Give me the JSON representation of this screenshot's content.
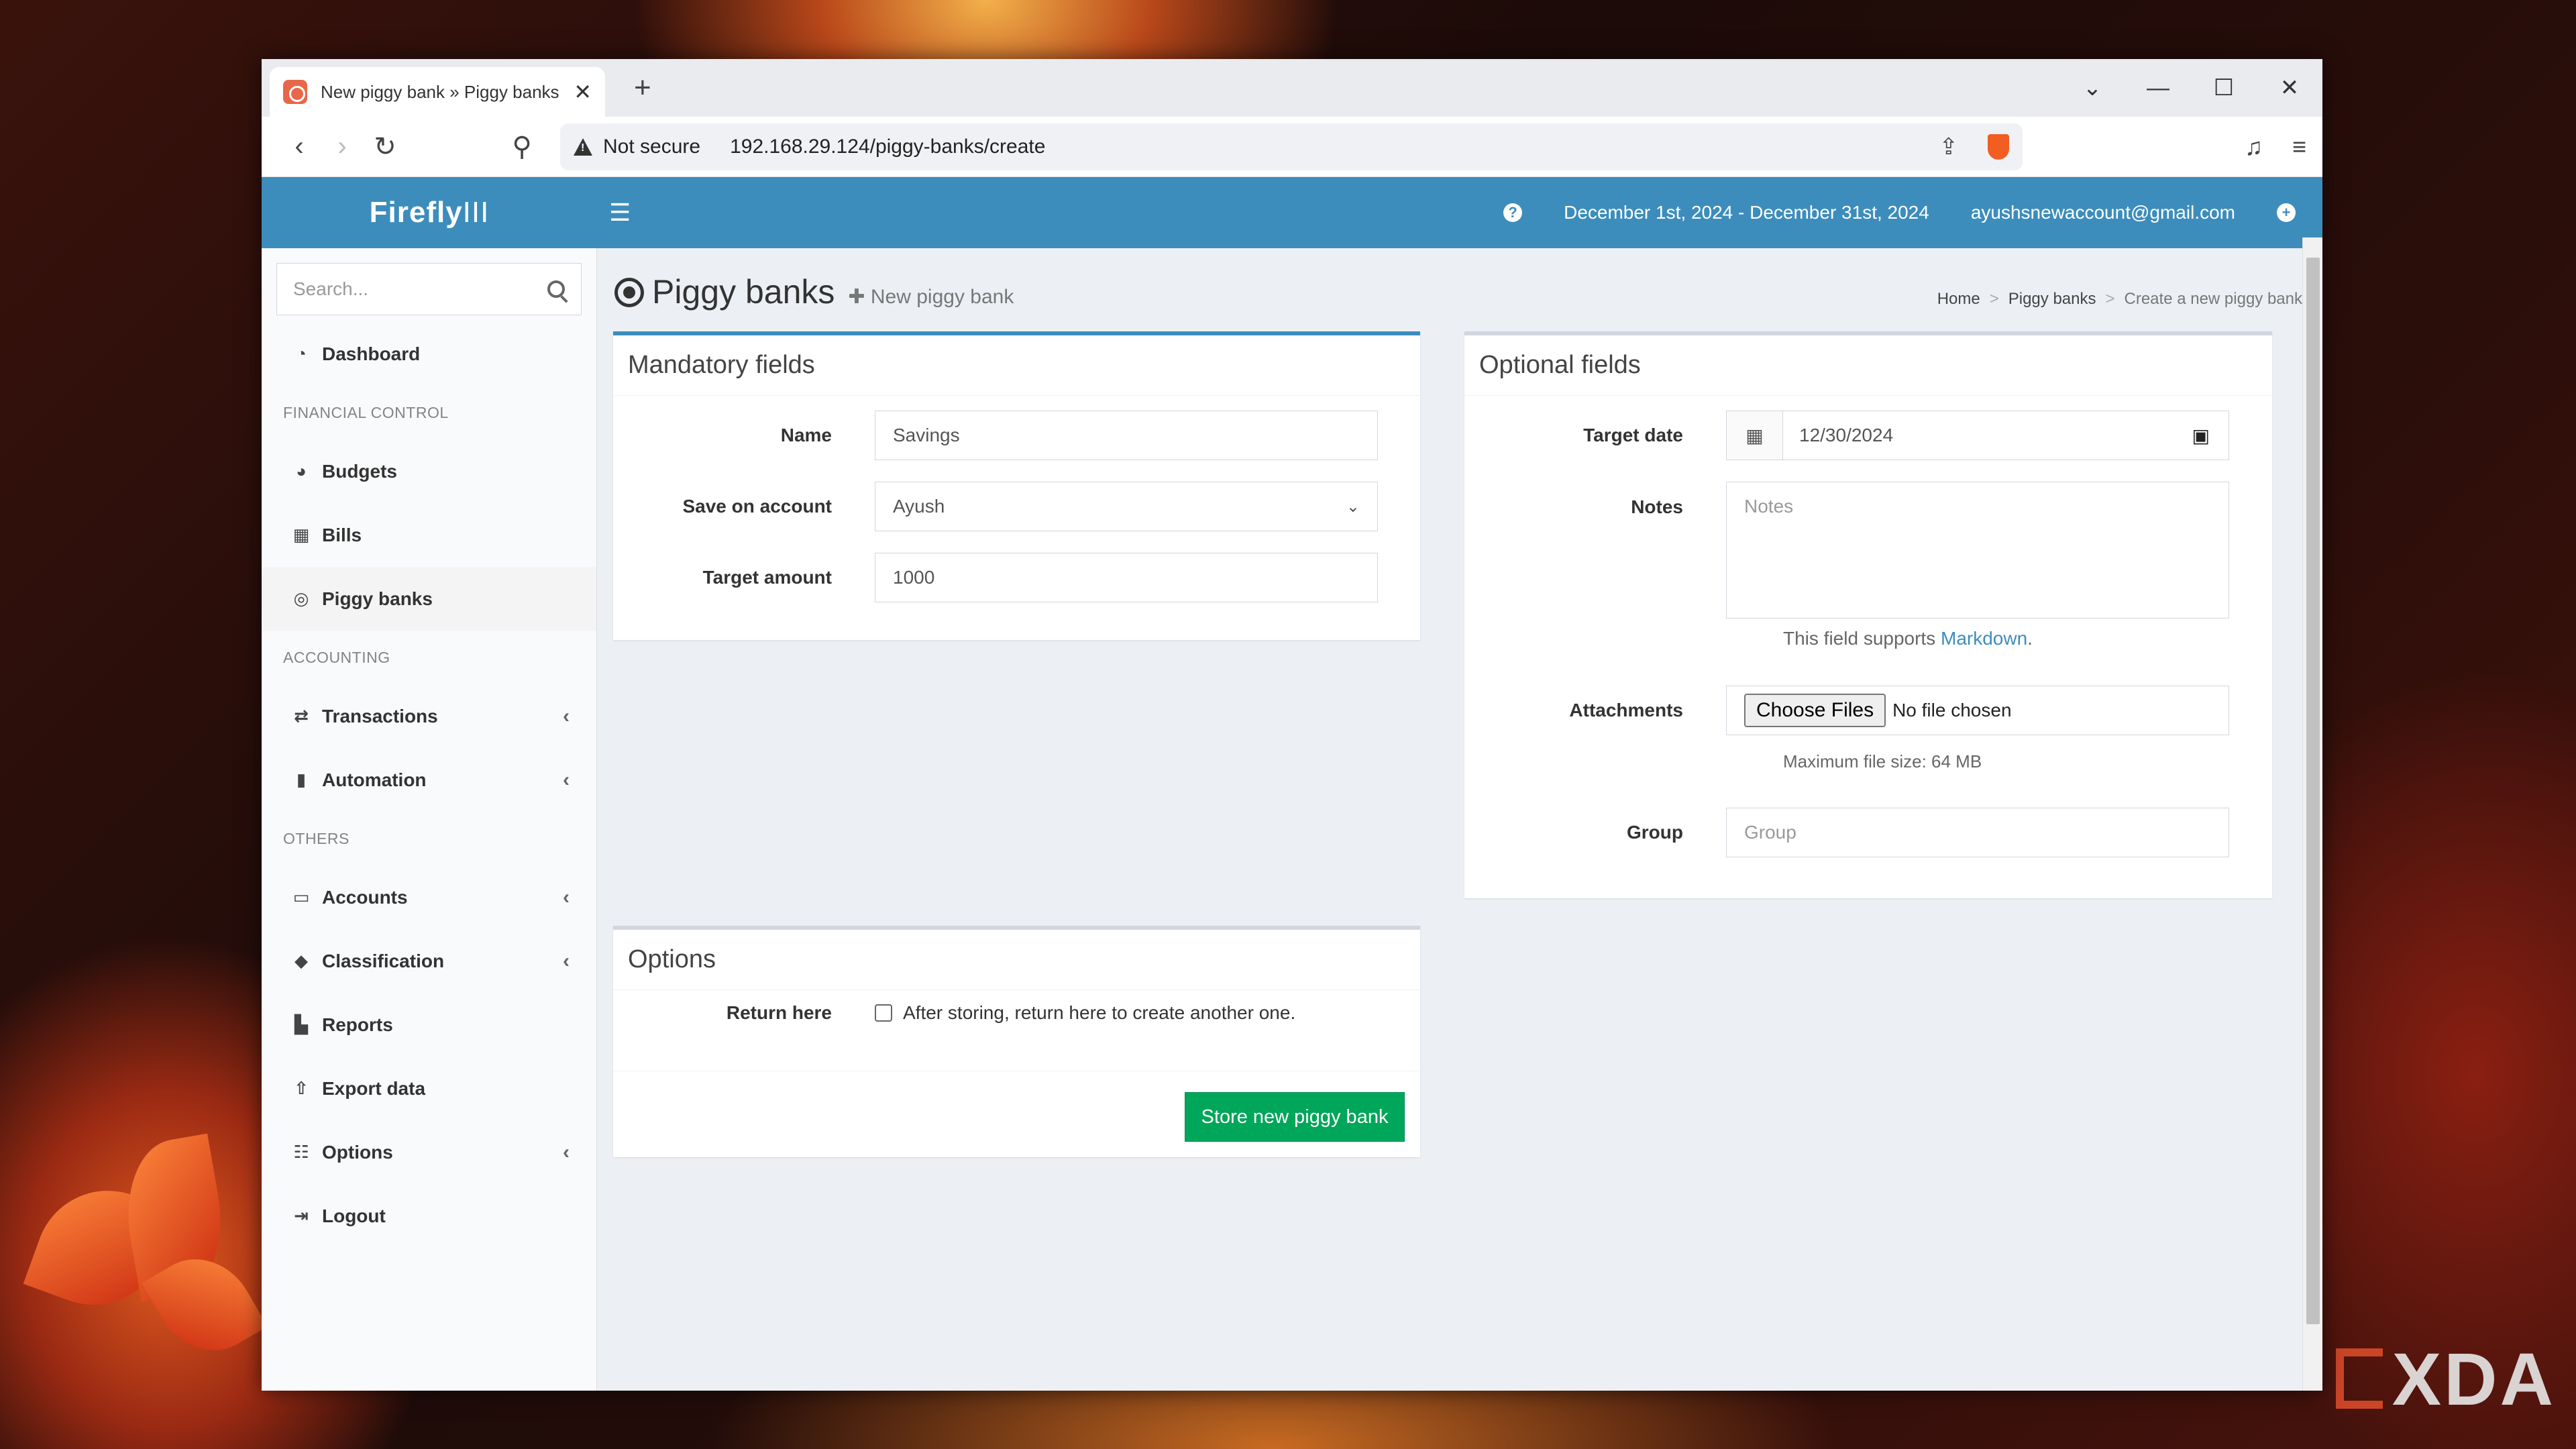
{
  "browser": {
    "tab_title": "New piggy bank » Piggy banks",
    "security_label": "Not secure",
    "url": "192.168.29.124/piggy-banks/create"
  },
  "app": {
    "logo_main": "Firefly",
    "logo_suffix": "III",
    "date_range": "December 1st, 2024 - December 31st, 2024",
    "user_email": "ayushsnewaccount@gmail.com"
  },
  "sidebar": {
    "search_placeholder": "Search...",
    "dashboard": "Dashboard",
    "header_financial": "FINANCIAL CONTROL",
    "budgets": "Budgets",
    "bills": "Bills",
    "piggy_banks": "Piggy banks",
    "header_accounting": "ACCOUNTING",
    "transactions": "Transactions",
    "automation": "Automation",
    "header_others": "OTHERS",
    "accounts": "Accounts",
    "classification": "Classification",
    "reports": "Reports",
    "export_data": "Export data",
    "options": "Options",
    "logout": "Logout"
  },
  "page": {
    "title": "Piggy banks",
    "subtitle": "New piggy bank",
    "breadcrumb": [
      "Home",
      "Piggy banks",
      "Create a new piggy bank"
    ]
  },
  "mandatory": {
    "heading": "Mandatory fields",
    "name_label": "Name",
    "name_value": "Savings",
    "account_label": "Save on account",
    "account_value": "Ayush",
    "amount_label": "Target amount",
    "amount_value": "1000"
  },
  "optional": {
    "heading": "Optional fields",
    "date_label": "Target date",
    "date_value": "12/30/2024",
    "notes_label": "Notes",
    "notes_placeholder": "Notes",
    "markdown_text": "This field supports",
    "markdown_link": "Markdown",
    "markdown_end": ".",
    "attachments_label": "Attachments",
    "choose_files": "Choose Files",
    "no_file": "No file chosen",
    "max_size": "Maximum file size: 64 MB",
    "group_label": "Group",
    "group_placeholder": "Group"
  },
  "options_box": {
    "heading": "Options",
    "return_label": "Return here",
    "return_text": "After storing, return here to create another one.",
    "return_checked": false,
    "submit": "Store new piggy bank"
  },
  "colors": {
    "topbar": "#3c8dbc",
    "submit": "#00a65a"
  },
  "watermark": "XDA"
}
